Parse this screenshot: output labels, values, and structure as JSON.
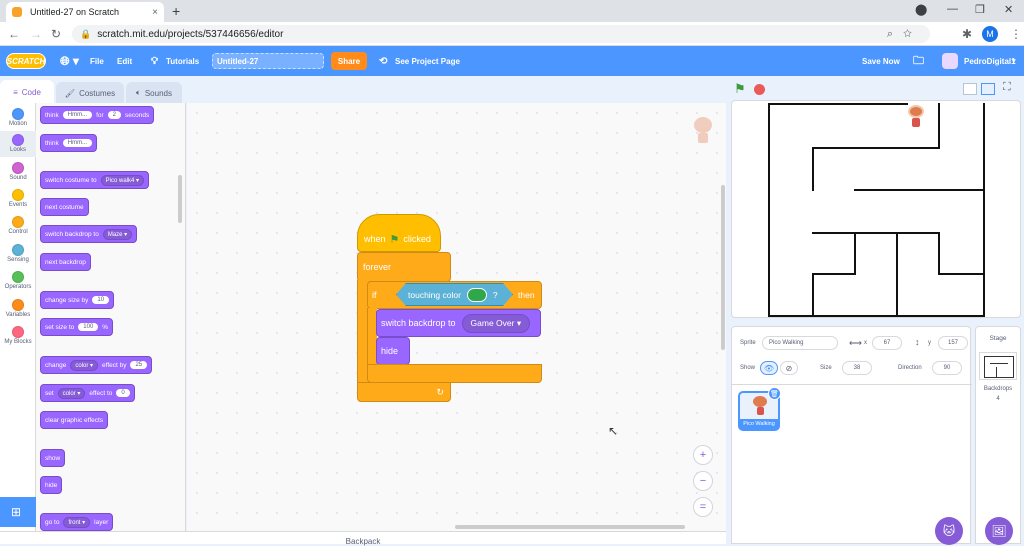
{
  "browser": {
    "tab_title": "Untitled-27 on Scratch",
    "tab_close": "×",
    "new_tab": "+",
    "url": "scratch.mit.edu/projects/537446656/editor",
    "profile_initial": "M",
    "window_controls": [
      "⬤",
      "—",
      "❐",
      "✕"
    ]
  },
  "menubar": {
    "logo": "SCRATCH",
    "file": "File",
    "edit": "Edit",
    "tutorials": "Tutorials",
    "project_title": "Untitled-27",
    "share": "Share",
    "see_project_page": "See Project Page",
    "save_now": "Save Now",
    "username": "PedroDigital1",
    "accent_color": "#4c97ff"
  },
  "editor_tabs": {
    "code": "Code",
    "costumes": "Costumes",
    "sounds": "Sounds"
  },
  "categories": [
    {
      "label": "Motion",
      "color": "#4c97ff"
    },
    {
      "label": "Looks",
      "color": "#9966ff"
    },
    {
      "label": "Sound",
      "color": "#cf63cf"
    },
    {
      "label": "Events",
      "color": "#ffbf00"
    },
    {
      "label": "Control",
      "color": "#ffab19"
    },
    {
      "label": "Sensing",
      "color": "#5cb1d6"
    },
    {
      "label": "Operators",
      "color": "#59c059"
    },
    {
      "label": "Variables",
      "color": "#ff8c1a"
    },
    {
      "label": "My Blocks",
      "color": "#ff6680"
    }
  ],
  "palette": {
    "think_for": {
      "w1": "think",
      "v1": "Hmm...",
      "w2": "for",
      "v2": "2",
      "w3": "seconds"
    },
    "think": {
      "w1": "think",
      "v1": "Hmm..."
    },
    "switch_costume": {
      "w1": "switch costume to",
      "v1": "Pico walk4 ▾"
    },
    "next_costume": "next costume",
    "switch_backdrop": {
      "w1": "switch backdrop to",
      "v1": "Maze ▾"
    },
    "next_backdrop": "next backdrop",
    "change_size": {
      "w1": "change size by",
      "v1": "10"
    },
    "set_size": {
      "w1": "set size to",
      "v1": "100",
      "w2": "%"
    },
    "change_effect": {
      "w1": "change",
      "v1": "color ▾",
      "w2": "effect by",
      "v2": "25"
    },
    "set_effect": {
      "w1": "set",
      "v1": "color ▾",
      "w2": "effect to",
      "v2": "0"
    },
    "clear_effects": "clear graphic effects",
    "show": "show",
    "hide": "hide",
    "go_to": {
      "w1": "go to",
      "v1": "front ▾",
      "w2": "layer"
    }
  },
  "script": {
    "when": "when",
    "clicked": "clicked",
    "forever": "forever",
    "if": "if",
    "touching": "touching color",
    "question": "?",
    "then": "then",
    "switch_backdrop": "switch backdrop to",
    "backdrop_value": "Game Over ▾",
    "hide": "hide",
    "loop_arrow": "↻"
  },
  "workspace": {
    "zoom_in": "+",
    "zoom_out": "−",
    "zoom_reset": "="
  },
  "backpack": "Backpack",
  "sprite_info": {
    "sprite_label": "Sprite",
    "sprite_name": "Pico Walking",
    "x_label": "x",
    "x_value": "67",
    "y_label": "y",
    "y_value": "157",
    "show_label": "Show",
    "size_label": "Size",
    "size_value": "38",
    "direction_label": "Direction",
    "direction_value": "90"
  },
  "sprite_tile_name": "Pico Walking",
  "stage_panel": {
    "title": "Stage",
    "backdrops_label": "Backdrops",
    "backdrops_count": "4"
  }
}
